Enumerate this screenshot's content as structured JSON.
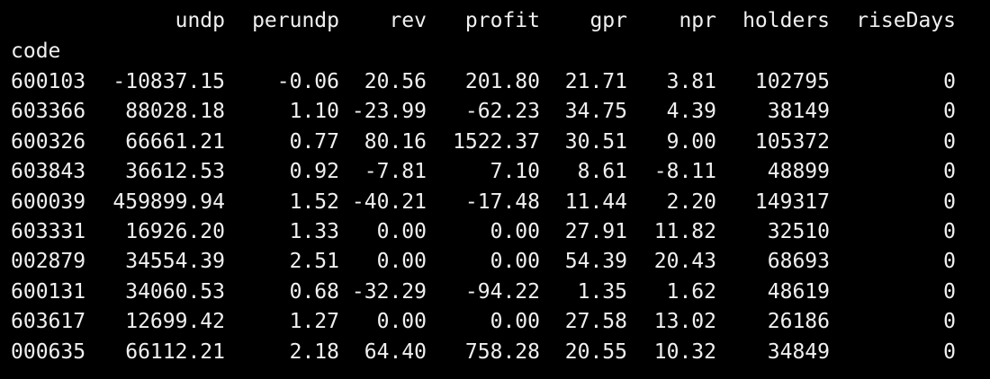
{
  "table": {
    "columns": [
      "undp",
      "perundp",
      "rev",
      "profit",
      "gpr",
      "npr",
      "holders",
      "riseDays"
    ],
    "index_name": "code",
    "rows": [
      {
        "code": "600103",
        "undp": "-10837.15",
        "perundp": "-0.06",
        "rev": "20.56",
        "profit": "201.80",
        "gpr": "21.71",
        "npr": "3.81",
        "holders": "102795",
        "riseDays": "0"
      },
      {
        "code": "603366",
        "undp": "88028.18",
        "perundp": "1.10",
        "rev": "-23.99",
        "profit": "-62.23",
        "gpr": "34.75",
        "npr": "4.39",
        "holders": "38149",
        "riseDays": "0"
      },
      {
        "code": "600326",
        "undp": "66661.21",
        "perundp": "0.77",
        "rev": "80.16",
        "profit": "1522.37",
        "gpr": "30.51",
        "npr": "9.00",
        "holders": "105372",
        "riseDays": "0"
      },
      {
        "code": "603843",
        "undp": "36612.53",
        "perundp": "0.92",
        "rev": "-7.81",
        "profit": "7.10",
        "gpr": "8.61",
        "npr": "-8.11",
        "holders": "48899",
        "riseDays": "0"
      },
      {
        "code": "600039",
        "undp": "459899.94",
        "perundp": "1.52",
        "rev": "-40.21",
        "profit": "-17.48",
        "gpr": "11.44",
        "npr": "2.20",
        "holders": "149317",
        "riseDays": "0"
      },
      {
        "code": "603331",
        "undp": "16926.20",
        "perundp": "1.33",
        "rev": "0.00",
        "profit": "0.00",
        "gpr": "27.91",
        "npr": "11.82",
        "holders": "32510",
        "riseDays": "0"
      },
      {
        "code": "002879",
        "undp": "34554.39",
        "perundp": "2.51",
        "rev": "0.00",
        "profit": "0.00",
        "gpr": "54.39",
        "npr": "20.43",
        "holders": "68693",
        "riseDays": "0"
      },
      {
        "code": "600131",
        "undp": "34060.53",
        "perundp": "0.68",
        "rev": "-32.29",
        "profit": "-94.22",
        "gpr": "1.35",
        "npr": "1.62",
        "holders": "48619",
        "riseDays": "0"
      },
      {
        "code": "603617",
        "undp": "12699.42",
        "perundp": "1.27",
        "rev": "0.00",
        "profit": "0.00",
        "gpr": "27.58",
        "npr": "13.02",
        "holders": "26186",
        "riseDays": "0"
      },
      {
        "code": "000635",
        "undp": "66112.21",
        "perundp": "2.18",
        "rev": "64.40",
        "profit": "758.28",
        "gpr": "20.55",
        "npr": "10.32",
        "holders": "34849",
        "riseDays": "0"
      }
    ]
  },
  "colors": {
    "background": "#000000",
    "text": "#f0f0f0"
  }
}
